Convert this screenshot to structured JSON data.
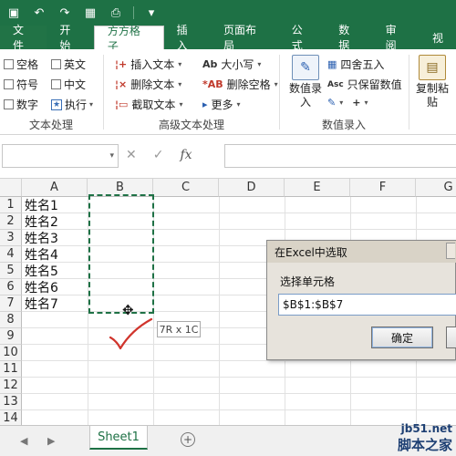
{
  "ribbon_tabs": [
    "文件",
    "开始",
    "方方格子",
    "插入",
    "页面布局",
    "公式",
    "数据",
    "审阅",
    "视"
  ],
  "active_tab": "方方格子",
  "text_processing": {
    "checkboxes": [
      "空格",
      "英文",
      "符号",
      "中文",
      "数字"
    ],
    "execute": "执行",
    "group_label": "文本处理"
  },
  "advanced_text": {
    "insert_text": "插入文本",
    "delete_text": "删除文本",
    "extract_text": "截取文本",
    "case": "大小写",
    "delete_space": "删除空格",
    "more": "更多",
    "group_label": "高级文本处理"
  },
  "data_entry": {
    "data_entry_btn": "数值录入",
    "round": "四舍五入",
    "keep_values": "只保留数值",
    "group_label": "数值录入"
  },
  "paste_btn": "复制粘贴",
  "formula_bar": {
    "fx": "fx",
    "cancel": "✕",
    "confirm": "✓"
  },
  "columns": [
    "A",
    "B",
    "C",
    "D",
    "E",
    "F",
    "G"
  ],
  "rows": [
    "1",
    "2",
    "3",
    "4",
    "5",
    "6",
    "7",
    "8",
    "9",
    "10",
    "11",
    "12",
    "13",
    "14"
  ],
  "cells_a": [
    "姓名1",
    "姓名2",
    "姓名3",
    "姓名4",
    "姓名5",
    "姓名6",
    "姓名7"
  ],
  "selection_tooltip": "7R x 1C",
  "dialog": {
    "title": "在Excel中选取",
    "label": "选择单元格",
    "value": "$B$1:$B$7",
    "ok": "确定"
  },
  "sheet_tab": "Sheet1",
  "watermark": {
    "url": "jb51.net",
    "brand": "脚本之家"
  },
  "colors": {
    "excel_green": "#1e7145",
    "checkmark_red": "#d0342c"
  }
}
